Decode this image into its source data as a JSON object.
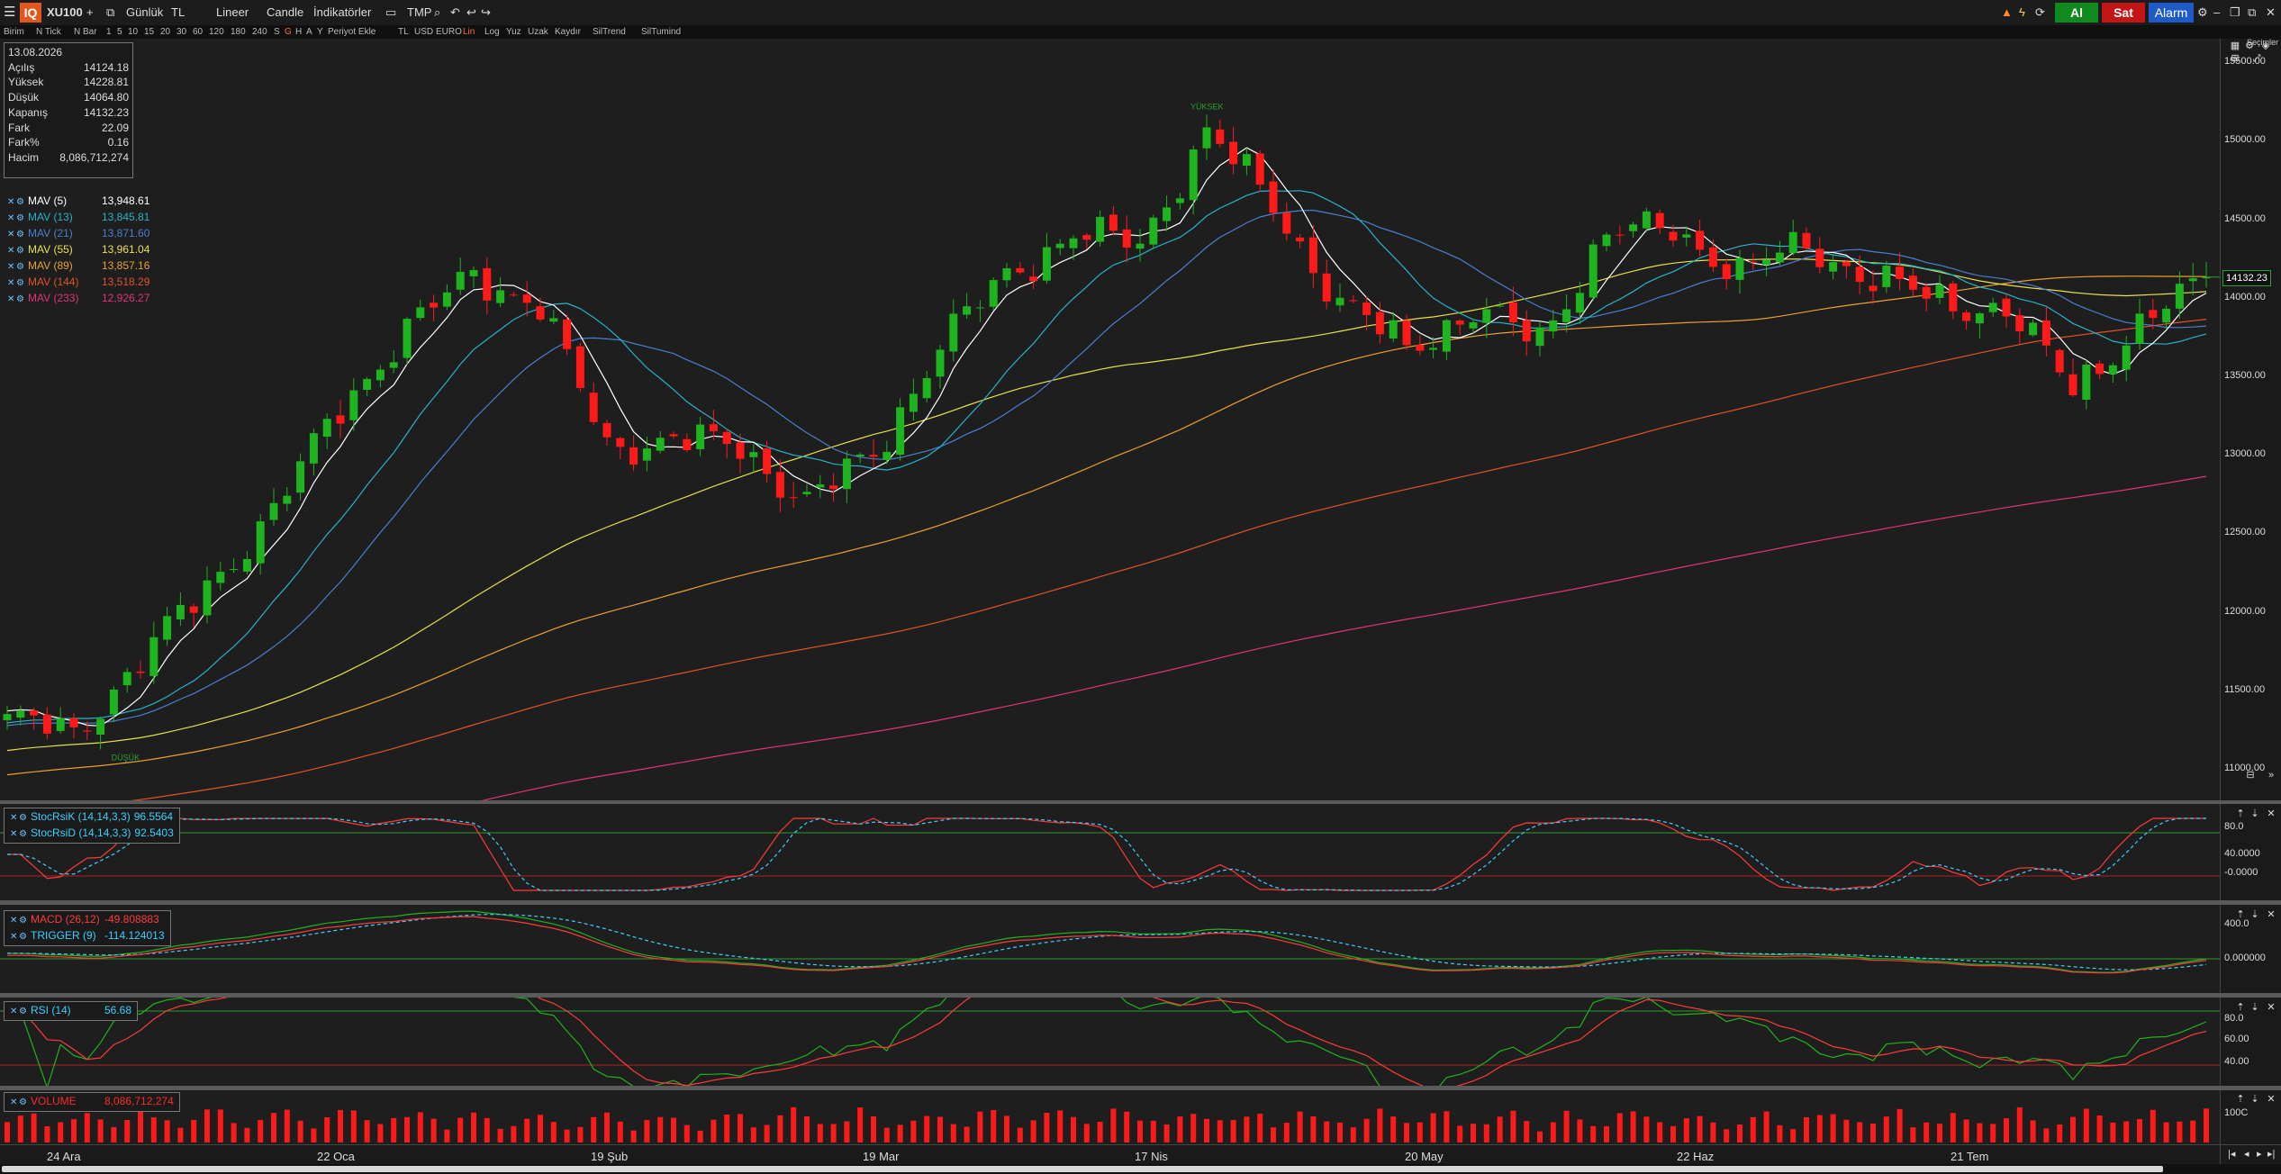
{
  "toolbar": {
    "symbol": "XU100",
    "add": "+",
    "period": "Günlük",
    "currency": "TL",
    "scale": "Lineer",
    "chart_type": "Candle",
    "indicators": "İndikatörler",
    "template": "TMP",
    "buy_label": "Al",
    "sell_label": "Sat",
    "alarm_label": "Alarm",
    "logo": "IQ"
  },
  "toolbar2": {
    "items": [
      "Birim",
      "N Tick",
      "N Bar",
      "1",
      "5",
      "10",
      "15",
      "20",
      "30",
      "60",
      "120",
      "180",
      "240",
      "S",
      "G",
      "H",
      "A",
      "Y",
      "Periyot Ekle",
      "TL",
      "USD",
      "EURO",
      "Lin",
      "Log",
      "Yuz",
      "Uzak",
      "Kaydır",
      "SilTrend",
      "SilTumind"
    ]
  },
  "info_box": {
    "date": "13.08.2026",
    "rows": [
      {
        "label": "Açılış",
        "value": "14124.18"
      },
      {
        "label": "Yüksek",
        "value": "14228.81"
      },
      {
        "label": "Düşük",
        "value": "14064.80"
      },
      {
        "label": "Kapanış",
        "value": "14132.23"
      },
      {
        "label": "Fark",
        "value": "22.09"
      },
      {
        "label": "Fark%",
        "value": "0.16"
      },
      {
        "label": "Hacim",
        "value": "8,086,712,274"
      }
    ]
  },
  "mav_legend": [
    {
      "label": "MAV (5)",
      "value": "13,948.61",
      "color": "#ffffff"
    },
    {
      "label": "MAV (13)",
      "value": "13,845.81",
      "color": "#27b3c9"
    },
    {
      "label": "MAV (21)",
      "value": "13,871.60",
      "color": "#4a7fd0"
    },
    {
      "label": "MAV (55)",
      "value": "13,961.04",
      "color": "#e8e04a"
    },
    {
      "label": "MAV (89)",
      "value": "13,857.16",
      "color": "#e8a033"
    },
    {
      "label": "MAV (144)",
      "value": "13,518.29",
      "color": "#e0532b"
    },
    {
      "label": "MAV (233)",
      "value": "12,926.27",
      "color": "#e0337a"
    }
  ],
  "price_axis": {
    "ticks": [
      "15500.00",
      "15000.00",
      "14500.00",
      "14000.00",
      "13500.00",
      "13000.00",
      "12500.00",
      "12000.00",
      "11500.00",
      "11000.00"
    ],
    "last_price": "14132.23",
    "corner_label": "Seçimler",
    "high_tag": "YÜKSEK",
    "low_tag": "DÜŞÜK"
  },
  "stochrsi": {
    "legend": [
      {
        "label": "StocRsiK (14,14,3,3)",
        "value": "96.5564"
      },
      {
        "label": "StocRsiD (14,14,3,3)",
        "value": "92.5403"
      }
    ],
    "ticks": [
      "80.0",
      "40.0000",
      "-0.0000"
    ]
  },
  "macd": {
    "legend": [
      {
        "label": "MACD (26,12)",
        "value": "-49.808883"
      },
      {
        "label": "TRIGGER (9)",
        "value": "-114.124013"
      }
    ],
    "ticks": [
      "400.0",
      "0.000000"
    ]
  },
  "rsi": {
    "legend": [
      {
        "label": "RSI (14)",
        "value": "56.68"
      }
    ],
    "ticks": [
      "80.0",
      "60.00",
      "40.00"
    ]
  },
  "volume": {
    "legend": [
      {
        "label": "VOLUME",
        "value": "8,086,712,274"
      }
    ],
    "ticks": [
      "100C"
    ]
  },
  "date_axis": [
    "24 Ara",
    "22 Oca",
    "19 Şub",
    "19 Mar",
    "17 Nis",
    "20 May",
    "22 Haz",
    "21 Tem"
  ],
  "colors": {
    "up": "#1fb31f",
    "down": "#ff1a1a",
    "background": "#1e1e1e"
  },
  "chart_data": {
    "type": "candlestick",
    "symbol": "XU100",
    "period": "Günlük",
    "ylim": [
      10800,
      15650
    ],
    "last": {
      "date": "13.08.2026",
      "open": 14124.18,
      "high": 14228.81,
      "low": 14064.8,
      "close": 14132.23,
      "volume": 8086712274
    },
    "close_path": [
      {
        "x": "24 Ara",
        "y": 11320
      },
      {
        "x": "01 Oca",
        "y": 11220
      },
      {
        "x": "08 Oca",
        "y": 11700
      },
      {
        "x": "15 Oca",
        "y": 12150
      },
      {
        "x": "22 Oca",
        "y": 12650
      },
      {
        "x": "29 Oca",
        "y": 13300
      },
      {
        "x": "05 Şub",
        "y": 13800
      },
      {
        "x": "12 Şub",
        "y": 14150
      },
      {
        "x": "19 Şub",
        "y": 13950
      },
      {
        "x": "26 Şub",
        "y": 13050
      },
      {
        "x": "05 Mar",
        "y": 13100
      },
      {
        "x": "12 Mar",
        "y": 13050
      },
      {
        "x": "19 Mar",
        "y": 12700
      },
      {
        "x": "26 Mar",
        "y": 13000
      },
      {
        "x": "02 Nis",
        "y": 13700
      },
      {
        "x": "09 Nis",
        "y": 14150
      },
      {
        "x": "17 Nis",
        "y": 14400
      },
      {
        "x": "24 Nis",
        "y": 14350
      },
      {
        "x": "01 May",
        "y": 15050
      },
      {
        "x": "08 May",
        "y": 14600
      },
      {
        "x": "15 May",
        "y": 13950
      },
      {
        "x": "20 May",
        "y": 13700
      },
      {
        "x": "27 May",
        "y": 13900
      },
      {
        "x": "03 Haz",
        "y": 13750
      },
      {
        "x": "10 Haz",
        "y": 14400
      },
      {
        "x": "17 Haz",
        "y": 14450
      },
      {
        "x": "22 Haz",
        "y": 14150
      },
      {
        "x": "29 Haz",
        "y": 14350
      },
      {
        "x": "06 Tem",
        "y": 14100
      },
      {
        "x": "13 Tem",
        "y": 14000
      },
      {
        "x": "21 Tem",
        "y": 13900
      },
      {
        "x": "28 Tem",
        "y": 13450
      },
      {
        "x": "04 Ağu",
        "y": 13800
      },
      {
        "x": "13 Ağu",
        "y": 14132
      }
    ],
    "mav_last": {
      "MAV5": 13948.61,
      "MAV13": 13845.81,
      "MAV21": 13871.6,
      "MAV55": 13961.04,
      "MAV89": 13857.16,
      "MAV144": 13518.29,
      "MAV233": 12926.27
    }
  }
}
